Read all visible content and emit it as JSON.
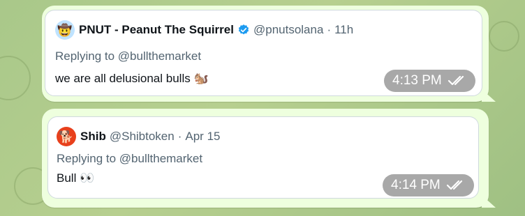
{
  "messages": [
    {
      "author_name": "PNUT - Peanut The Squirrel",
      "handle": "@pnutsolana",
      "separator": "·",
      "time_ago": "11h",
      "reply_prefix": "Replying to",
      "reply_to": "@bullthemarket",
      "text": "we are all delusional bulls",
      "emoji": "🐿️",
      "avatar_icon": "🤠",
      "verified": true,
      "sent_time": "4:13 PM"
    },
    {
      "author_name": "Shib",
      "handle": "@Shibtoken",
      "separator": "·",
      "time_ago": "Apr 15",
      "reply_prefix": "Replying to",
      "reply_to": "@bullthemarket",
      "text": "Bull",
      "emoji": "👀",
      "avatar_icon": "🐕",
      "verified": false,
      "sent_time": "4:14 PM"
    }
  ],
  "colors": {
    "bubble": "#eeffde",
    "verified": "#1d9bf0",
    "muted": "#536471",
    "time_pill": "#a8a8a8"
  }
}
